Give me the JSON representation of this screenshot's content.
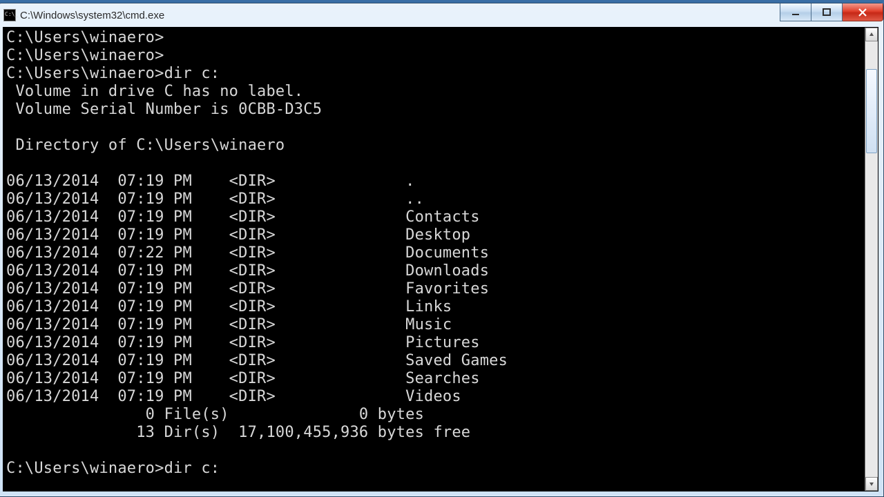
{
  "window": {
    "title": "C:\\Windows\\system32\\cmd.exe"
  },
  "terminal": {
    "prompt": "C:\\Users\\winaero>",
    "cmd": "dir c:",
    "vol1": " Volume in drive C has no label.",
    "vol2": " Volume Serial Number is 0CBB-D3C5",
    "dirOf": " Directory of C:\\Users\\winaero",
    "rows": [
      {
        "date": "06/13/2014",
        "time": "07:19 PM",
        "type": "<DIR>",
        "name": "."
      },
      {
        "date": "06/13/2014",
        "time": "07:19 PM",
        "type": "<DIR>",
        "name": ".."
      },
      {
        "date": "06/13/2014",
        "time": "07:19 PM",
        "type": "<DIR>",
        "name": "Contacts"
      },
      {
        "date": "06/13/2014",
        "time": "07:19 PM",
        "type": "<DIR>",
        "name": "Desktop"
      },
      {
        "date": "06/13/2014",
        "time": "07:22 PM",
        "type": "<DIR>",
        "name": "Documents"
      },
      {
        "date": "06/13/2014",
        "time": "07:19 PM",
        "type": "<DIR>",
        "name": "Downloads"
      },
      {
        "date": "06/13/2014",
        "time": "07:19 PM",
        "type": "<DIR>",
        "name": "Favorites"
      },
      {
        "date": "06/13/2014",
        "time": "07:19 PM",
        "type": "<DIR>",
        "name": "Links"
      },
      {
        "date": "06/13/2014",
        "time": "07:19 PM",
        "type": "<DIR>",
        "name": "Music"
      },
      {
        "date": "06/13/2014",
        "time": "07:19 PM",
        "type": "<DIR>",
        "name": "Pictures"
      },
      {
        "date": "06/13/2014",
        "time": "07:19 PM",
        "type": "<DIR>",
        "name": "Saved Games"
      },
      {
        "date": "06/13/2014",
        "time": "07:19 PM",
        "type": "<DIR>",
        "name": "Searches"
      },
      {
        "date": "06/13/2014",
        "time": "07:19 PM",
        "type": "<DIR>",
        "name": "Videos"
      }
    ],
    "summary1": "               0 File(s)              0 bytes",
    "summary2": "              13 Dir(s)  17,100,455,936 bytes free"
  }
}
